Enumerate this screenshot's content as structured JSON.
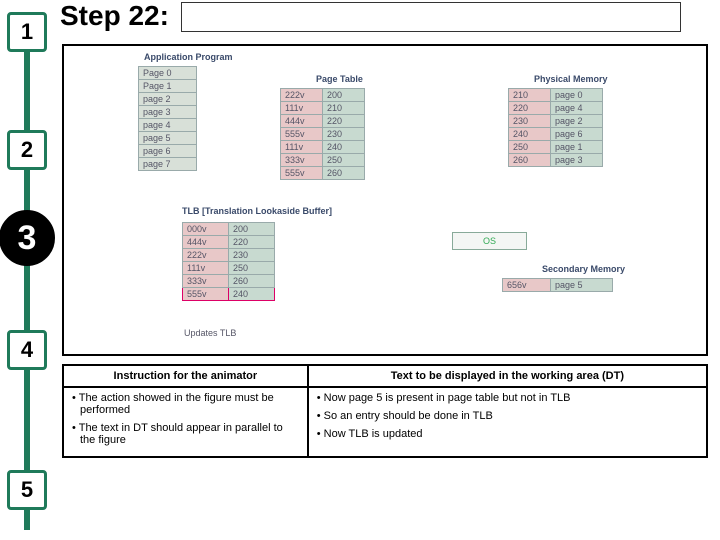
{
  "step_label": "Step 22:",
  "rail": {
    "stops": [
      "1",
      "2",
      "3",
      "4",
      "5"
    ],
    "active_index": 2
  },
  "diagram": {
    "app_label": "Application Program",
    "pt_label": "Page Table",
    "pm_label": "Physical Memory",
    "tlb_label": "TLB [Translation Lookaside Buffer]",
    "os_label": "OS",
    "sm_label": "Secondary Memory",
    "updates_label": "Updates TLB",
    "app_rows": [
      "Page 0",
      "Page 1",
      "page 2",
      "page 3",
      "page 4",
      "page 5",
      "page 6",
      "page 7"
    ],
    "pt_rows": [
      [
        "222v",
        "200"
      ],
      [
        "111v",
        "210"
      ],
      [
        "444v",
        "220"
      ],
      [
        "555v",
        "230"
      ],
      [
        "111v",
        "240"
      ],
      [
        "333v",
        "250"
      ],
      [
        "555v",
        "260"
      ]
    ],
    "pm_rows": [
      [
        "210",
        "page 0"
      ],
      [
        "220",
        "page 4"
      ],
      [
        "230",
        "page 2"
      ],
      [
        "240",
        "page 6"
      ],
      [
        "250",
        "page 1"
      ],
      [
        "260",
        "page 3"
      ]
    ],
    "tlb_rows": [
      [
        "000v",
        "200"
      ],
      [
        "444v",
        "220"
      ],
      [
        "222v",
        "230"
      ],
      [
        "111v",
        "250"
      ],
      [
        "333v",
        "260"
      ],
      [
        "555v",
        "240"
      ]
    ],
    "tlb_highlight_row": 5,
    "sm_rows": [
      [
        "656v",
        "page 5"
      ]
    ]
  },
  "bottom": {
    "left_header": "Instruction for the animator",
    "right_header": "Text to be displayed in the working area (DT)",
    "left_items": [
      "The action showed in the figure must be performed",
      "The text in DT should appear  in parallel to the figure"
    ],
    "right_items": [
      "Now  page 5 is present in page table but not in TLB",
      "So an entry should be done in TLB",
      "Now TLB is updated"
    ]
  }
}
